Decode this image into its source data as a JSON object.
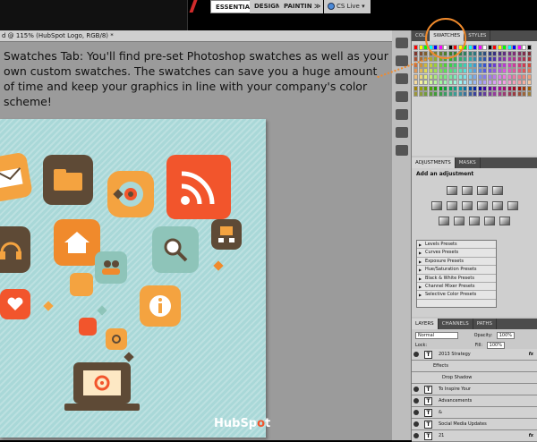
{
  "app_bar": {
    "workspaces": [
      "ESSENTIALS",
      "DESIGN",
      "PAINTING"
    ],
    "more_label": "≫",
    "cs_live": "CS Live ▾"
  },
  "document": {
    "tab_title": "d @ 115% (HubSpot Logo, RGB/8) *",
    "caption": "Swatches Tab: You'll find pre-set Photoshop swatches as well as your own custom swatches. The swatches can save you a huge amount of time and keep your graphics in line with your company's color scheme!",
    "logo_text": "HubSp",
    "logo_text_tail": "t"
  },
  "swatches_panel": {
    "tabs": [
      "COL",
      "SWATCHES",
      "STYLES"
    ],
    "active_tab": "SWATCHES"
  },
  "adjustments_panel": {
    "tabs": [
      "ADJUSTMENTS",
      "MASKS"
    ],
    "title": "Add an adjustment",
    "presets": [
      "Levels Presets",
      "Curves Presets",
      "Exposure Presets",
      "Hue/Saturation Presets",
      "Black & White Presets",
      "Channel Mixer Presets",
      "Selective Color Presets"
    ]
  },
  "layers_panel": {
    "tabs": [
      "LAYERS",
      "CHANNELS",
      "PATHS"
    ],
    "blend_mode": "Normal",
    "opacity_label": "Opacity:",
    "opacity_value": "100%",
    "lock_label": "Lock:",
    "fill_label": "Fill:",
    "fill_value": "100%",
    "layers": [
      {
        "name": "2013 Strategy",
        "fx": "fx",
        "type": "text"
      },
      {
        "name": "Effects",
        "type": "sub"
      },
      {
        "name": "Drop Shadow",
        "type": "sub2"
      },
      {
        "name": "To Inspire Your",
        "type": "text"
      },
      {
        "name": "Advancements",
        "type": "text"
      },
      {
        "name": "&",
        "type": "text"
      },
      {
        "name": "Social Media Updates",
        "type": "text"
      },
      {
        "name": "21",
        "fx": "fx",
        "type": "text"
      }
    ]
  },
  "colors": {
    "accent_orange": "#f08a2c",
    "hubspot_orange": "#f2552c",
    "canvas_teal": "#a9d8d8"
  }
}
